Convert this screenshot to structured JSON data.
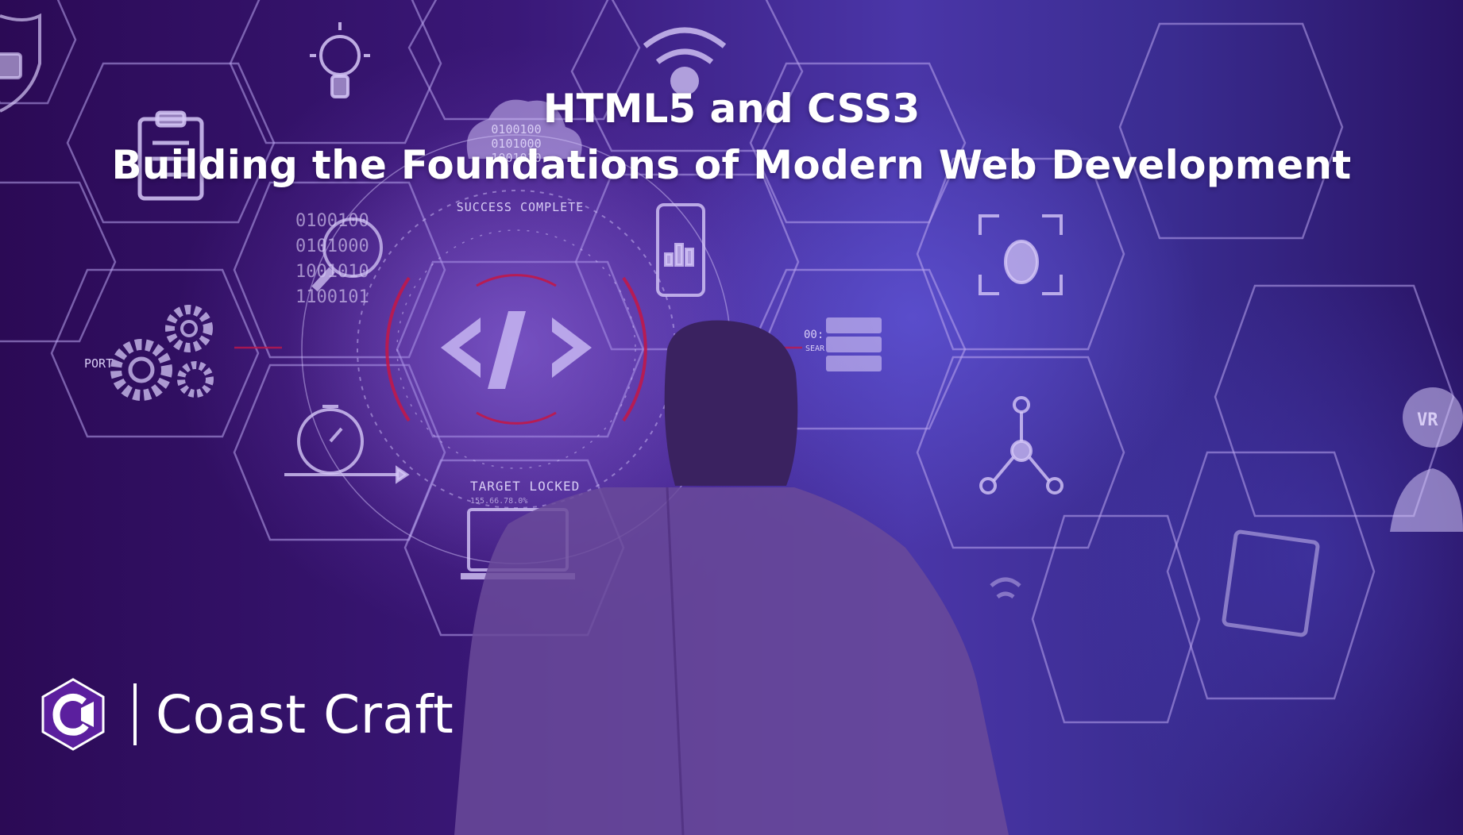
{
  "slide": {
    "title_line1": "HTML5 and CSS3",
    "title_line2": "Building the Foundations of Modern Web Development"
  },
  "brand": {
    "name": "Coast Craft",
    "logo_icon": "coast-craft-hexagon-logo-icon",
    "logo_color": "#5b1f9e"
  },
  "hud": {
    "code_symbol": "</>",
    "success_label": "SUCCESS COMPLETE",
    "target_label": "TARGET LOCKED",
    "target_sub": "155.66.78.0%",
    "binary_top": [
      "0100100",
      "0101000",
      "1001010"
    ],
    "binary_left": [
      "0100100",
      "0101000",
      "1001010",
      "1100101"
    ],
    "port_label": "PORT",
    "vr_label": "VR",
    "timer_label": "00:",
    "search_label": "SEAR"
  },
  "colors": {
    "overlay_purple": "#3a1878",
    "accent_red": "#c0184a",
    "text": "#ffffff"
  }
}
